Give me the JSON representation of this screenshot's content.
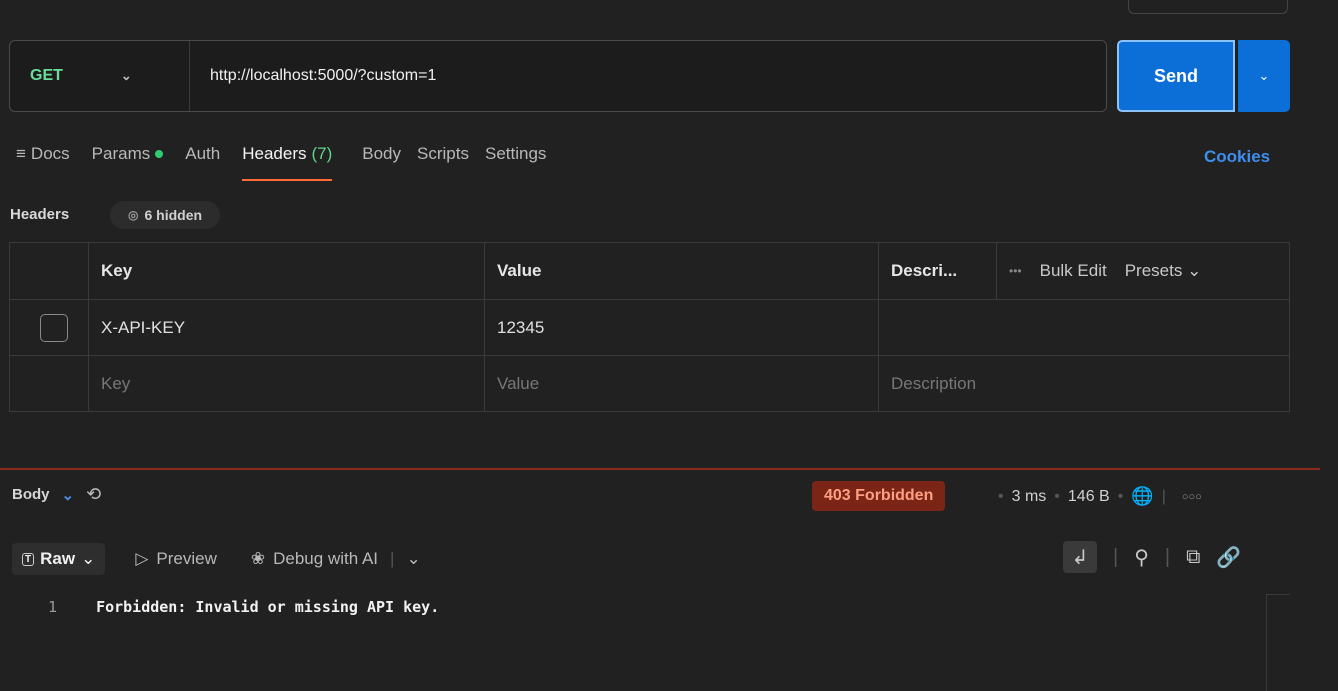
{
  "request": {
    "method": "GET",
    "url": "http://localhost:5000/?custom=1",
    "send_label": "Send"
  },
  "tabs": [
    {
      "label": "Docs",
      "icon": "docs-icon"
    },
    {
      "label": "Params",
      "dot": true
    },
    {
      "label": "Auth"
    },
    {
      "label": "Headers",
      "count": "(7)",
      "active": true
    },
    {
      "label": "Body"
    },
    {
      "label": "Scripts"
    },
    {
      "label": "Settings"
    }
  ],
  "cookies_label": "Cookies",
  "headers_section": {
    "title": "Headers",
    "hidden_label": "6 hidden",
    "columns": {
      "key": "Key",
      "value": "Value",
      "description": "Descri...",
      "bulk_edit": "Bulk Edit",
      "presets": "Presets"
    },
    "rows": [
      {
        "key": "X-API-KEY",
        "value": "12345",
        "description": ""
      }
    ],
    "placeholders": {
      "key": "Key",
      "value": "Value",
      "description": "Description"
    }
  },
  "response": {
    "section_label": "Body",
    "status": "403 Forbidden",
    "time": "3 ms",
    "size": "146 B",
    "status_color": "#7a2516",
    "format_label": "Raw",
    "preview_label": "Preview",
    "debug_label": "Debug with AI",
    "lines": [
      {
        "no": "1",
        "text": "Forbidden: Invalid or missing API key."
      }
    ]
  }
}
